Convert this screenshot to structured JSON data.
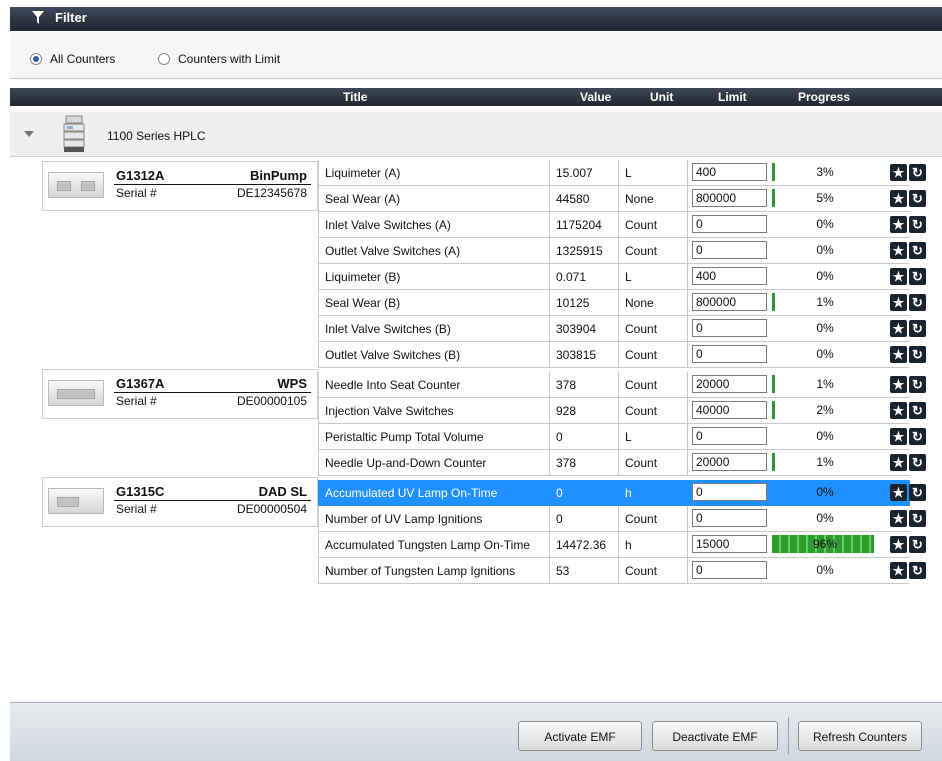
{
  "filter": {
    "title": "Filter",
    "options": [
      {
        "label": "All Counters",
        "selected": true
      },
      {
        "label": "Counters with Limit",
        "selected": false
      }
    ]
  },
  "columns": {
    "title": "Title",
    "value": "Value",
    "unit": "Unit",
    "limit": "Limit",
    "progress": "Progress"
  },
  "group": {
    "label": "1100 Series HPLC"
  },
  "modules": [
    {
      "part": "G1312A",
      "name": "BinPump",
      "serial_label": "Serial #",
      "serial": "DE12345678"
    },
    {
      "part": "G1367A",
      "name": "WPS",
      "serial_label": "Serial #",
      "serial": "DE00000105"
    },
    {
      "part": "G1315C",
      "name": "DAD SL",
      "serial_label": "Serial #",
      "serial": "DE00000504"
    }
  ],
  "rows": [
    {
      "title": "Liquimeter (A)",
      "value": "15.007",
      "unit": "L",
      "limit": "400",
      "progress": "3%",
      "pct": 3
    },
    {
      "title": "Seal Wear (A)",
      "value": "44580",
      "unit": "None",
      "limit": "800000",
      "progress": "5%",
      "pct": 5
    },
    {
      "title": "Inlet Valve Switches (A)",
      "value": "1175204",
      "unit": "Count",
      "limit": "0",
      "progress": "0%",
      "pct": 0
    },
    {
      "title": "Outlet Valve Switches (A)",
      "value": "1325915",
      "unit": "Count",
      "limit": "0",
      "progress": "0%",
      "pct": 0
    },
    {
      "title": "Liquimeter (B)",
      "value": "0.071",
      "unit": "L",
      "limit": "400",
      "progress": "0%",
      "pct": 0
    },
    {
      "title": "Seal Wear (B)",
      "value": "10125",
      "unit": "None",
      "limit": "800000",
      "progress": "1%",
      "pct": 1
    },
    {
      "title": "Inlet Valve Switches (B)",
      "value": "303904",
      "unit": "Count",
      "limit": "0",
      "progress": "0%",
      "pct": 0
    },
    {
      "title": "Outlet Valve Switches (B)",
      "value": "303815",
      "unit": "Count",
      "limit": "0",
      "progress": "0%",
      "pct": 0
    },
    {
      "title": "Needle Into Seat Counter",
      "value": "378",
      "unit": "Count",
      "limit": "20000",
      "progress": "1%",
      "pct": 1
    },
    {
      "title": "Injection Valve Switches",
      "value": "928",
      "unit": "Count",
      "limit": "40000",
      "progress": "2%",
      "pct": 2
    },
    {
      "title": "Peristaltic Pump Total Volume",
      "value": "0",
      "unit": "L",
      "limit": "0",
      "progress": "0%",
      "pct": 0
    },
    {
      "title": "Needle Up-and-Down Counter",
      "value": "378",
      "unit": "Count",
      "limit": "20000",
      "progress": "1%",
      "pct": 1
    },
    {
      "title": "Accumulated UV Lamp On-Time",
      "value": "0",
      "unit": "h",
      "limit": "0",
      "progress": "0%",
      "pct": 0,
      "selected": true
    },
    {
      "title": "Number of UV Lamp Ignitions",
      "value": "0",
      "unit": "Count",
      "limit": "0",
      "progress": "0%",
      "pct": 0
    },
    {
      "title": "Accumulated Tungsten Lamp On-Time",
      "value": "14472.36",
      "unit": "h",
      "limit": "15000",
      "progress": "96%",
      "pct": 96
    },
    {
      "title": "Number of Tungsten Lamp Ignitions",
      "value": "53",
      "unit": "Count",
      "limit": "0",
      "progress": "0%",
      "pct": 0
    }
  ],
  "footer": {
    "activate": "Activate EMF",
    "deactivate": "Deactivate EMF",
    "refresh": "Refresh Counters"
  },
  "colors": {
    "header_bg": "#1f2833",
    "selection": "#1e90ff",
    "progress_green": "#3aae3a"
  },
  "icons": {
    "filter": "funnel-icon",
    "star": "star-icon",
    "reset": "reset-icon",
    "expand": "collapse-triangle-icon",
    "instrument": "hplc-stack-icon"
  }
}
